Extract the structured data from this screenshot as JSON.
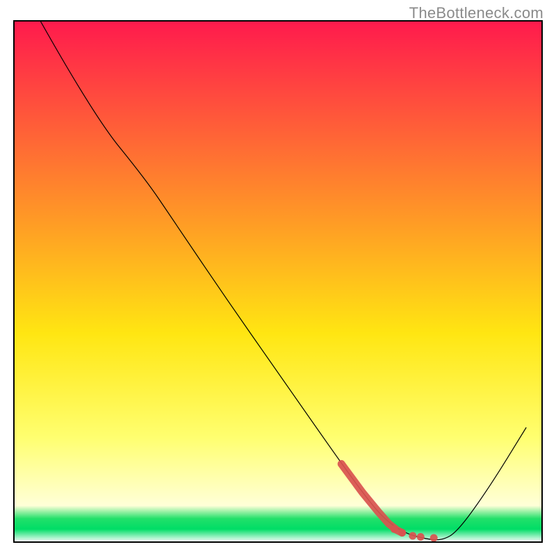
{
  "watermark": "TheBottleneck.com",
  "chart_data": {
    "type": "line",
    "title": "",
    "xlabel": "",
    "ylabel": "",
    "xlim": [
      0,
      100
    ],
    "ylim": [
      0,
      100
    ],
    "background_gradient": {
      "stops": [
        {
          "offset": 0.0,
          "color": "#ff1a4d"
        },
        {
          "offset": 0.4,
          "color": "#ffa024"
        },
        {
          "offset": 0.6,
          "color": "#ffe612"
        },
        {
          "offset": 0.8,
          "color": "#ffff70"
        },
        {
          "offset": 0.93,
          "color": "#ffffd8"
        },
        {
          "offset": 0.955,
          "color": "#22e06a"
        },
        {
          "offset": 0.975,
          "color": "#00dd66"
        },
        {
          "offset": 1.0,
          "color": "#ffffff"
        }
      ]
    },
    "series": [
      {
        "name": "bottleneck-curve",
        "color": "#000000",
        "width": 1.2,
        "points": [
          {
            "x": 5.0,
            "y": 100.0
          },
          {
            "x": 15.0,
            "y": 82.0
          },
          {
            "x": 25.0,
            "y": 69.5
          },
          {
            "x": 30.0,
            "y": 62.0
          },
          {
            "x": 40.0,
            "y": 47.0
          },
          {
            "x": 50.0,
            "y": 32.5
          },
          {
            "x": 60.0,
            "y": 18.0
          },
          {
            "x": 66.0,
            "y": 9.5
          },
          {
            "x": 70.0,
            "y": 4.5
          },
          {
            "x": 74.0,
            "y": 1.7
          },
          {
            "x": 78.0,
            "y": 0.6
          },
          {
            "x": 81.0,
            "y": 0.3
          },
          {
            "x": 84.0,
            "y": 2.0
          },
          {
            "x": 90.0,
            "y": 10.5
          },
          {
            "x": 97.0,
            "y": 22.0
          }
        ]
      },
      {
        "name": "highlight-region",
        "color": "#d9534f",
        "role": "highlight",
        "stroke_points": [
          {
            "x": 62.0,
            "y": 15.0
          },
          {
            "x": 66.0,
            "y": 9.5
          },
          {
            "x": 69.0,
            "y": 5.8
          },
          {
            "x": 71.0,
            "y": 3.5
          },
          {
            "x": 72.5,
            "y": 2.3
          },
          {
            "x": 73.5,
            "y": 1.8
          }
        ],
        "dots": [
          {
            "x": 72.0,
            "y": 2.5
          },
          {
            "x": 73.5,
            "y": 1.8
          },
          {
            "x": 75.5,
            "y": 1.2
          },
          {
            "x": 77.0,
            "y": 1.0
          },
          {
            "x": 79.5,
            "y": 0.8
          }
        ]
      }
    ]
  }
}
